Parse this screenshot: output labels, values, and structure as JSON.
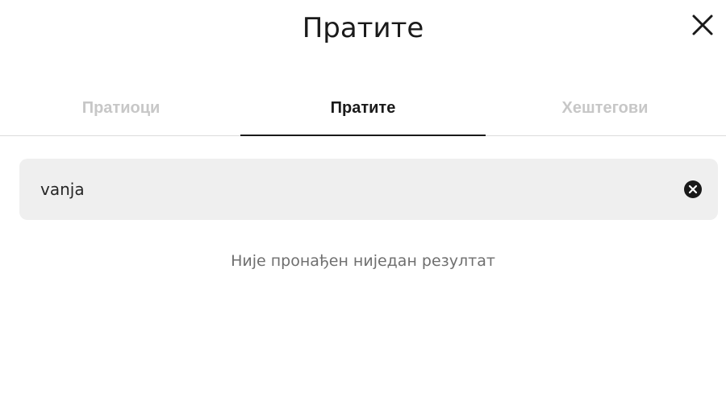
{
  "header": {
    "title": "Пратите",
    "close_icon": "close-icon"
  },
  "tabs": [
    {
      "label": "Пратиоци",
      "active": false
    },
    {
      "label": "Пратите",
      "active": true
    },
    {
      "label": "Хештегови",
      "active": false
    }
  ],
  "search": {
    "value": "vanja",
    "placeholder": "",
    "clear_icon": "clear-circle-icon"
  },
  "results": {
    "empty_message": "Није пронађен ниједан резултат"
  },
  "colors": {
    "active_text": "#1a1a1a",
    "inactive_tab": "#c7c7c7",
    "search_bg": "#efefef",
    "muted_text": "#6f6f6f",
    "divider": "#dbdbdb"
  }
}
